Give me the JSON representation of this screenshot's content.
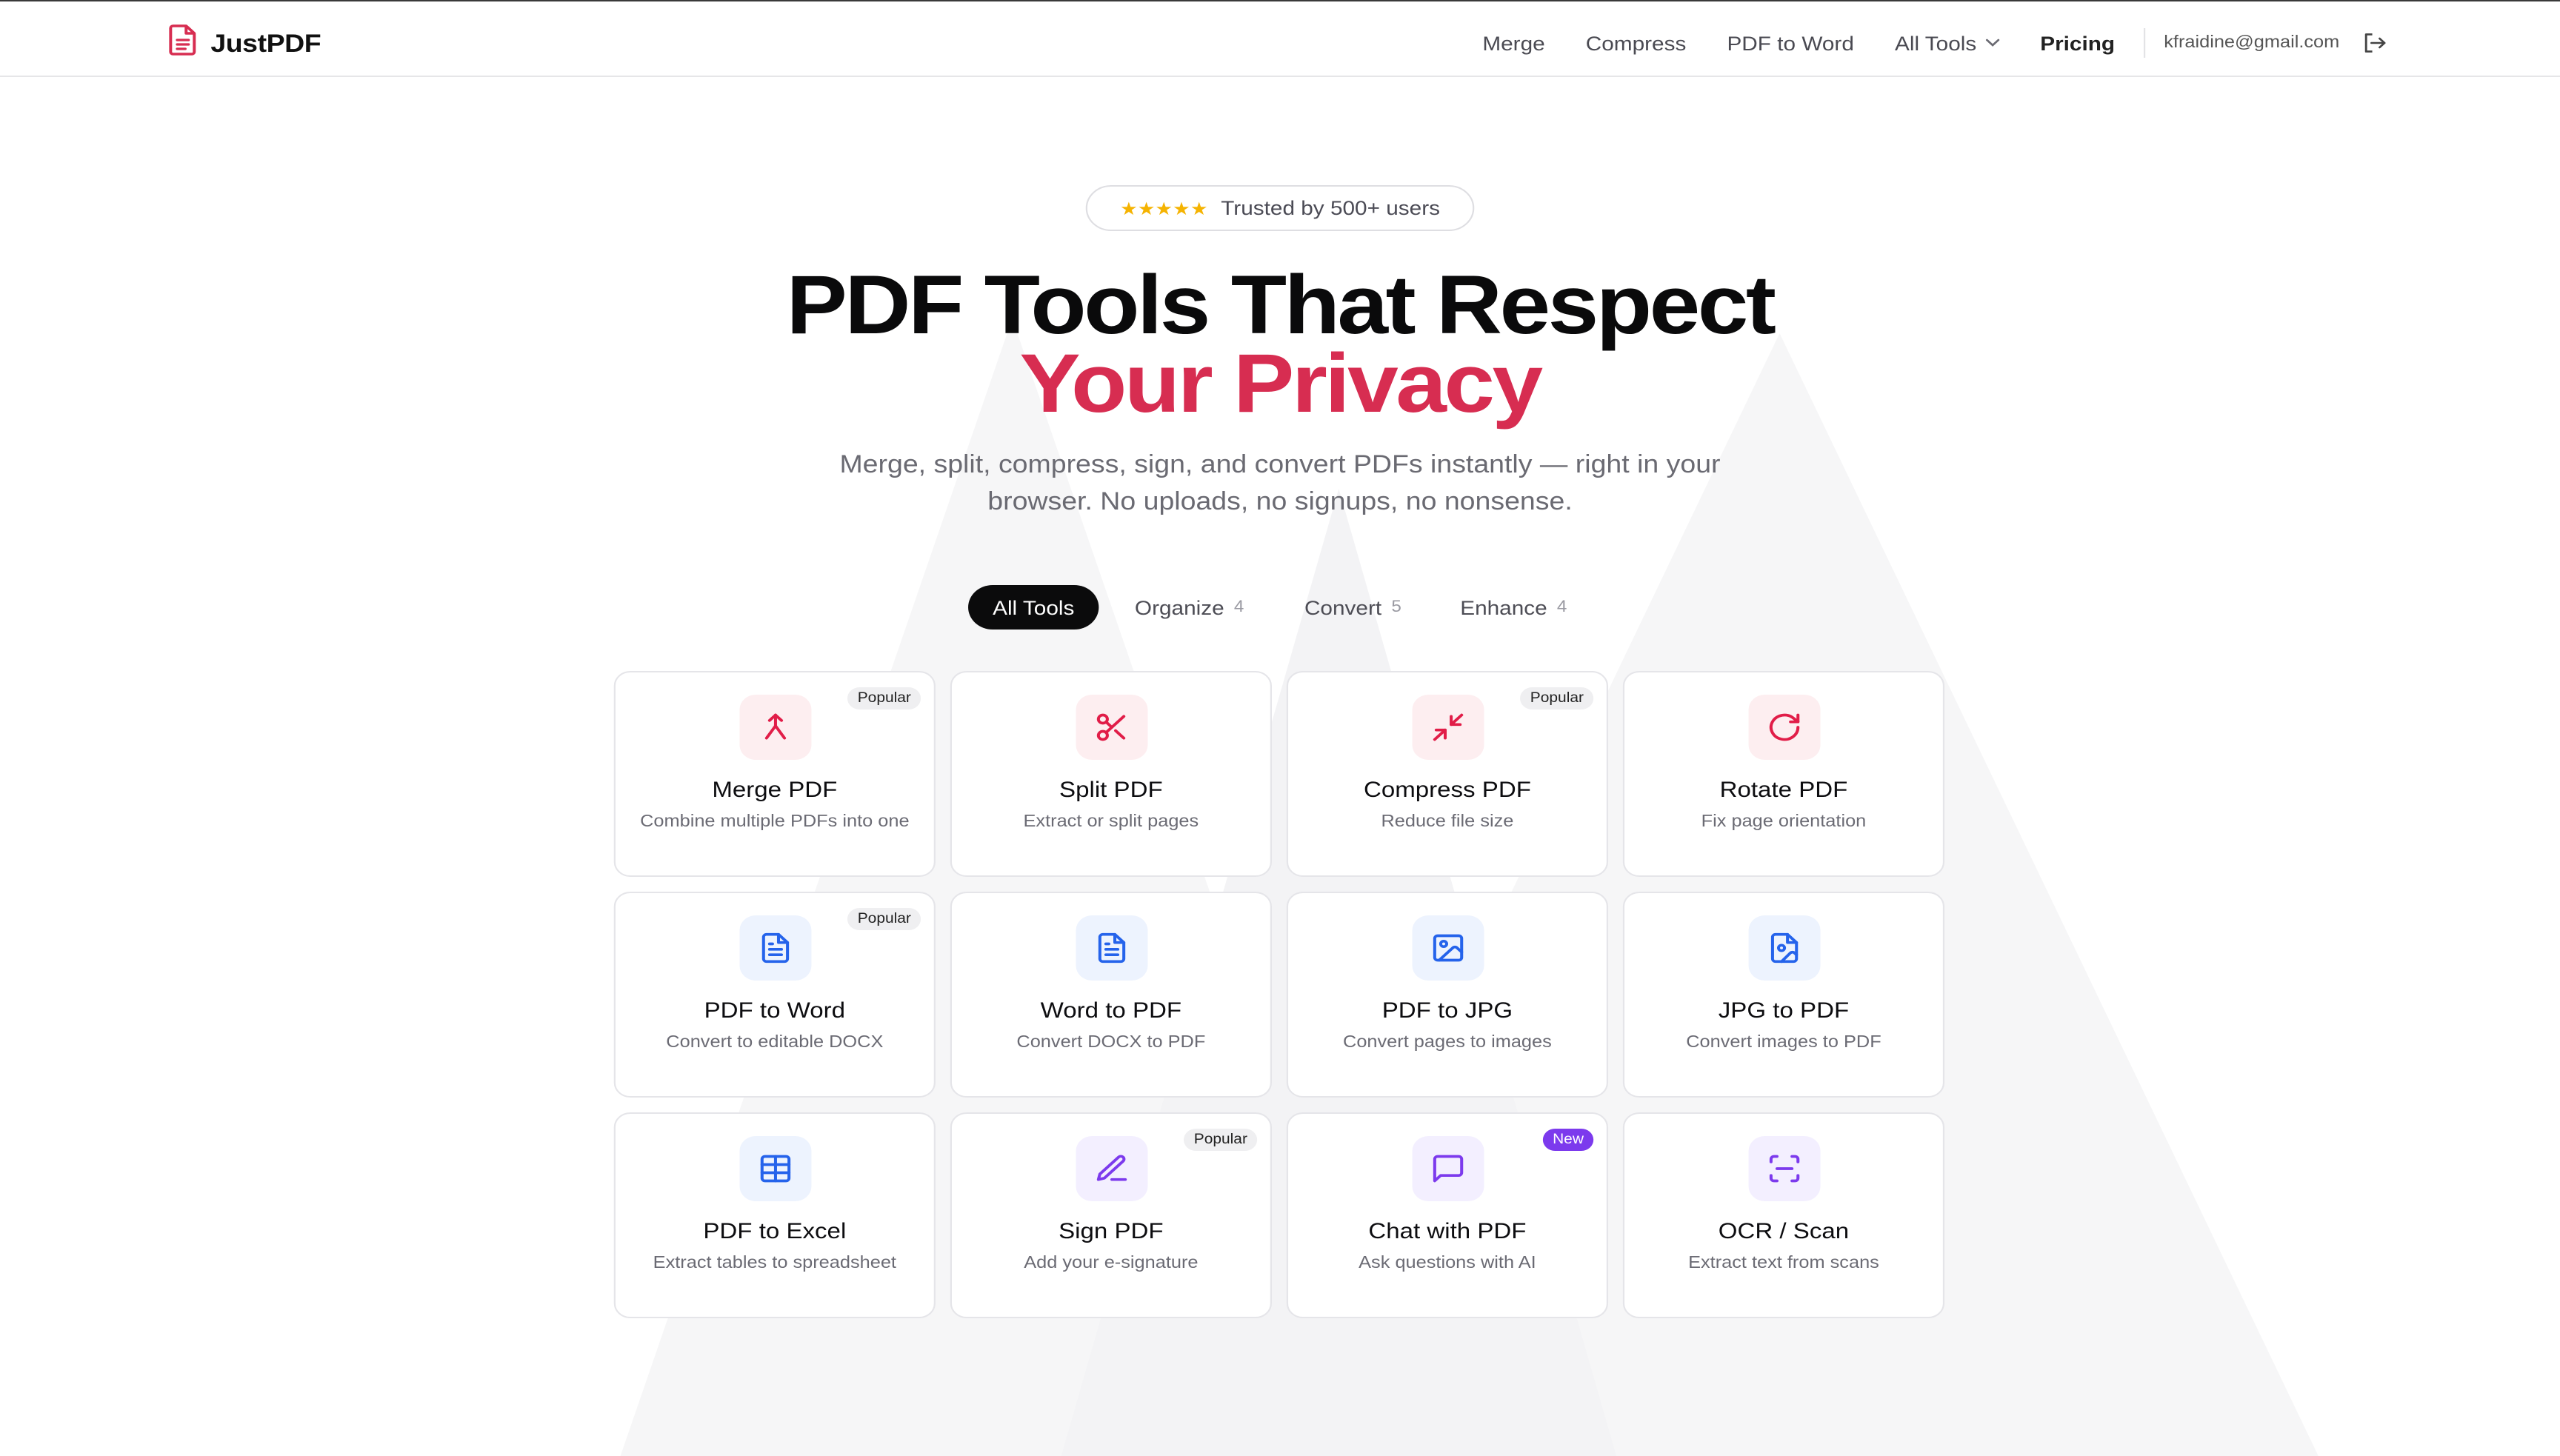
{
  "header": {
    "app_name": "JustPDF",
    "nav": [
      "Merge",
      "Compress",
      "PDF to Word",
      "All Tools",
      "Pricing"
    ],
    "email": "kfraidine@gmail.com"
  },
  "hero": {
    "badge_stars": "★★★★★",
    "badge_text": "Trusted by 500+ users",
    "title_line1": "PDF Tools That Respect",
    "title_line2": "Your Privacy",
    "subtitle_line1": "Merge, split, compress, sign, and convert PDFs instantly — right in your",
    "subtitle_line2": "browser. No uploads, no signups, no nonsense."
  },
  "tabs": [
    {
      "label": "All Tools",
      "count": ""
    },
    {
      "label": "Organize",
      "count": "4"
    },
    {
      "label": "Convert",
      "count": "5"
    },
    {
      "label": "Enhance",
      "count": "4"
    }
  ],
  "tools": [
    {
      "title": "Merge PDF",
      "desc": "Combine multiple PDFs into one",
      "tag": "Popular",
      "icon": "merge-icon",
      "tint": "red"
    },
    {
      "title": "Split PDF",
      "desc": "Extract or split pages",
      "tag": "",
      "icon": "scissors-icon",
      "tint": "red"
    },
    {
      "title": "Compress PDF",
      "desc": "Reduce file size",
      "tag": "Popular",
      "icon": "compress-arrows-icon",
      "tint": "red"
    },
    {
      "title": "Rotate PDF",
      "desc": "Fix page orientation",
      "tag": "",
      "icon": "rotate-icon",
      "tint": "red"
    },
    {
      "title": "PDF to Word",
      "desc": "Convert to editable DOCX",
      "tag": "Popular",
      "icon": "document-icon",
      "tint": "blue"
    },
    {
      "title": "Word to PDF",
      "desc": "Convert DOCX to PDF",
      "tag": "",
      "icon": "document-icon",
      "tint": "blue"
    },
    {
      "title": "PDF to JPG",
      "desc": "Convert pages to images",
      "tag": "",
      "icon": "image-icon",
      "tint": "blue"
    },
    {
      "title": "JPG to PDF",
      "desc": "Convert images to PDF",
      "tag": "",
      "icon": "file-image-icon",
      "tint": "blue"
    },
    {
      "title": "PDF to Excel",
      "desc": "Extract tables to spreadsheet",
      "tag": "",
      "icon": "table-icon",
      "tint": "blue"
    },
    {
      "title": "Sign PDF",
      "desc": "Add your e-signature",
      "tag": "Popular",
      "icon": "pen-icon",
      "tint": "purple"
    },
    {
      "title": "Chat with PDF",
      "desc": "Ask questions with AI",
      "tag": "New",
      "icon": "chat-icon",
      "tint": "purple"
    },
    {
      "title": "OCR / Scan",
      "desc": "Extract text from scans",
      "tag": "",
      "icon": "scan-icon",
      "tint": "purple"
    }
  ],
  "colors": {
    "accent": "#d72d51",
    "tool_red": "#e11d48",
    "tool_blue": "#2563eb",
    "tool_purple": "#7c3aed",
    "new_badge": "#7c3aed"
  }
}
